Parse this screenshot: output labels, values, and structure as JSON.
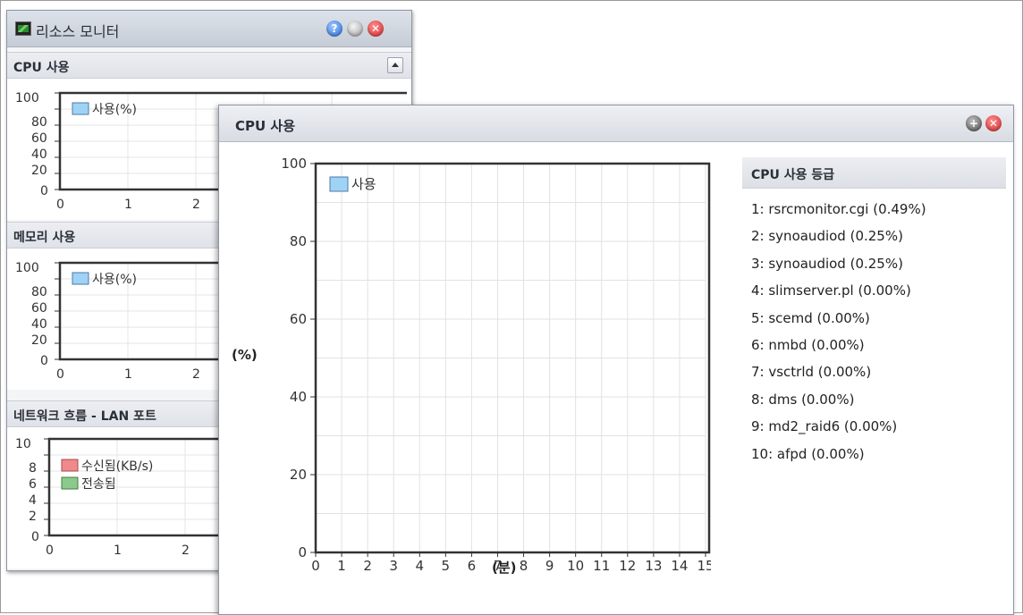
{
  "resource_monitor": {
    "title": "리소스 모니터",
    "cpu_section": {
      "title": "CPU 사용",
      "y_ticks": [
        "100",
        "80",
        "60",
        "40",
        "20",
        "0"
      ],
      "x_ticks": [
        "0",
        "1",
        "2"
      ],
      "legend": "사용(%)"
    },
    "memory_section": {
      "title": "메모리 사용",
      "y_ticks": [
        "100",
        "80",
        "60",
        "40",
        "20",
        "0"
      ],
      "x_ticks": [
        "0",
        "1",
        "2"
      ],
      "legend": "사용(%)"
    },
    "network_section": {
      "title": "네트워크 흐름 - LAN 포트",
      "y_ticks": [
        "10",
        "8",
        "6",
        "4",
        "2",
        "0"
      ],
      "x_ticks": [
        "0",
        "1",
        "2"
      ],
      "legend_rx": "수신됨(KB/s)",
      "legend_tx": "전송됨"
    }
  },
  "cpu_window": {
    "title": "CPU 사용",
    "y_axis_label": "(%)",
    "x_axis_label": "(분)",
    "legend": "사용",
    "ranking": {
      "title": "CPU 사용 등급",
      "items": [
        "1: rsrcmonitor.cgi (0.49%)",
        "2: synoaudiod (0.25%)",
        "3: synoaudiod (0.25%)",
        "4: slimserver.pl (0.00%)",
        "5: scemd (0.00%)",
        "6: nmbd (0.00%)",
        "7: vsctrld (0.00%)",
        "8: dms (0.00%)",
        "9: md2_raid6 (0.00%)",
        "10: afpd (0.00%)"
      ]
    }
  },
  "colors": {
    "usage_legend": "#9fd3f5",
    "rx_legend": "#f08a8a",
    "tx_legend": "#8cc98c",
    "close": "#d42c2c",
    "help": "#2c6fd4"
  },
  "chart_data": {
    "type": "line",
    "title": "CPU 사용",
    "xlabel": "(분)",
    "ylabel": "(%)",
    "x_ticks": [
      "0",
      "1",
      "2",
      "3",
      "4",
      "5",
      "6",
      "7",
      "8",
      "9",
      "10",
      "11",
      "12",
      "13",
      "14",
      "15"
    ],
    "y_ticks": [
      "100",
      "80",
      "60",
      "40",
      "20",
      "0"
    ],
    "xlim": [
      0,
      15
    ],
    "ylim": [
      0,
      100
    ],
    "grid": true,
    "legend_position": "top-left",
    "series": [
      {
        "name": "사용",
        "values": []
      }
    ]
  }
}
